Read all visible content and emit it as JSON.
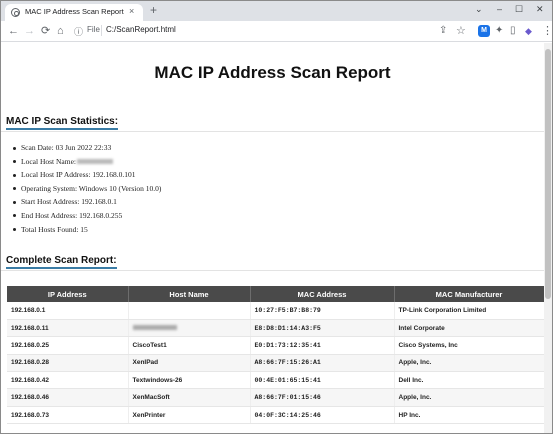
{
  "browser": {
    "tab_title": "MAC IP Address Scan Report",
    "tab_close": "×",
    "new_tab": "+",
    "window_controls": {
      "chevron": "⌄",
      "minimize": "–",
      "maximize": "☐",
      "close": "✕"
    },
    "toolbar": {
      "back": "←",
      "forward": "→",
      "reload": "⟳",
      "home": "⌂",
      "info": "ⓘ",
      "scheme_label": "File",
      "url": "C:/ScanReport.html",
      "share": "⇪",
      "star": "☆",
      "extension_badge": "M",
      "puzzle": "✦",
      "sidepanel": "▯",
      "gem": "◆",
      "menu": "⋮"
    }
  },
  "report": {
    "title": "MAC IP Address Scan Report",
    "stats_heading": "MAC IP Scan Statistics:",
    "stats": [
      {
        "label": "Scan Date: 03 Jun 2022 22:33",
        "redacted": false
      },
      {
        "label": "Local Host Name:",
        "redacted": true
      },
      {
        "label": "Local Host IP Address: 192.168.0.101",
        "redacted": false
      },
      {
        "label": "Operating System: Windows 10 (Version 10.0)",
        "redacted": false
      },
      {
        "label": "Start Host Address: 192.168.0.1",
        "redacted": false
      },
      {
        "label": "End Host Address: 192.168.0.255",
        "redacted": false
      },
      {
        "label": "Total Hosts Found: 15",
        "redacted": false
      }
    ],
    "table_heading": "Complete Scan Report:",
    "columns": [
      "IP Address",
      "Host Name",
      "MAC Address",
      "MAC Manufacturer"
    ],
    "rows": [
      {
        "ip": "192.168.0.1",
        "host": "",
        "host_redacted": false,
        "mac": "10:27:F5:B7:B8:79",
        "manufacturer": "TP-Link Corporation Limited"
      },
      {
        "ip": "192.168.0.11",
        "host": "",
        "host_redacted": true,
        "mac": "E8:D8:D1:14:A3:F5",
        "manufacturer": "Intel Corporate"
      },
      {
        "ip": "192.168.0.25",
        "host": "CiscoTest1",
        "host_redacted": false,
        "mac": "E0:D1:73:12:35:41",
        "manufacturer": "Cisco Systems, Inc"
      },
      {
        "ip": "192.168.0.28",
        "host": "XenIPad",
        "host_redacted": false,
        "mac": "A8:66:7F:15:26:A1",
        "manufacturer": "Apple, Inc."
      },
      {
        "ip": "192.168.0.42",
        "host": "Textwindows-26",
        "host_redacted": false,
        "mac": "00:4E:01:65:15:41",
        "manufacturer": "Dell Inc."
      },
      {
        "ip": "192.168.0.46",
        "host": "XenMacSoft",
        "host_redacted": false,
        "mac": "A8:66:7F:01:15:46",
        "manufacturer": "Apple, Inc."
      },
      {
        "ip": "192.168.0.73",
        "host": "XenPrinter",
        "host_redacted": false,
        "mac": "04:0F:3C:14:25:46",
        "manufacturer": "HP Inc."
      }
    ]
  },
  "colors": {
    "table_header": "#4a4a4a",
    "heading_underline": "#3a7ca5",
    "tab_strip": "#dee1e6",
    "extension_badge": "#1a73e8"
  }
}
